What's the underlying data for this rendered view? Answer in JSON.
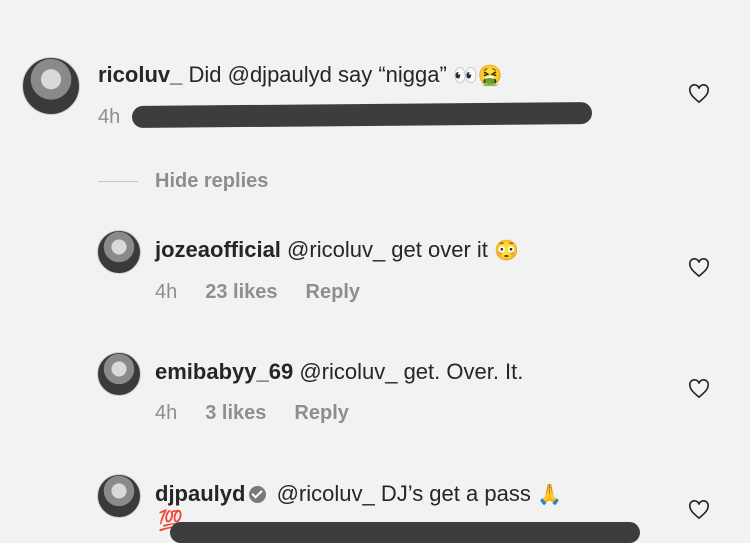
{
  "comments": [
    {
      "username": "ricoluv_",
      "text": " Did @djpaulyd say “nigga” ",
      "emoji": "👀🤮",
      "time": "4h"
    },
    {
      "username": "jozeaofficial",
      "text": " @ricoluv_ get over it ",
      "emoji": "😳",
      "time": "4h",
      "likes": "23 likes",
      "reply": "Reply"
    },
    {
      "username": "emibabyy_69",
      "text": " @ricoluv_  get. Over. It.",
      "time": "4h",
      "likes": "3 likes",
      "reply": "Reply"
    },
    {
      "username": "djpaulyd",
      "text": " @ricoluv_ DJ’s get a pass ",
      "emoji": "🙏",
      "emoji2": "💯"
    }
  ],
  "hide_replies": "Hide replies",
  "icons": {
    "like": "heart-outline-icon",
    "verified": "verified-badge-icon"
  },
  "colors": {
    "text": "#262626",
    "muted": "#8e8e8e",
    "background": "#f2f2f2",
    "redaction": "#3d3d3d"
  }
}
